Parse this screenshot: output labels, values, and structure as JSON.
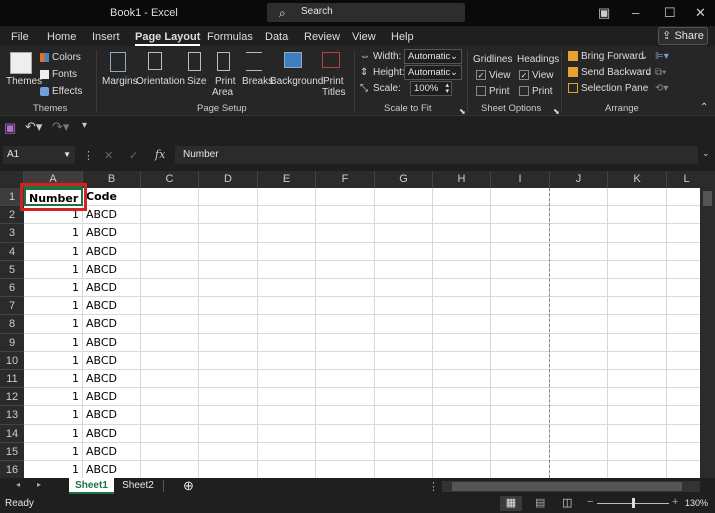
{
  "window": {
    "title": "Book1  -  Excel",
    "search_placeholder": "Search"
  },
  "tabs": [
    "File",
    "Home",
    "Insert",
    "Page Layout",
    "Formulas",
    "Data",
    "Review",
    "View",
    "Help"
  ],
  "active_tab": "Page Layout",
  "share_label": "Share",
  "ribbon": {
    "themes": {
      "themes": "Themes",
      "colors": "Colors",
      "fonts": "Fonts",
      "effects": "Effects",
      "group": "Themes"
    },
    "page_setup": {
      "margins": "Margins",
      "orientation": "Orientation",
      "size": "Size",
      "print_area_1": "Print",
      "print_area_2": "Area",
      "breaks": "Breaks",
      "background": "Background",
      "print_titles_1": "Print",
      "print_titles_2": "Titles",
      "group": "Page Setup"
    },
    "scale": {
      "width_label": "Width:",
      "width_value": "Automatic",
      "height_label": "Height:",
      "height_value": "Automatic",
      "scale_label": "Scale:",
      "scale_value": "100%",
      "group": "Scale to Fit"
    },
    "sheet_options": {
      "gridlines": "Gridlines",
      "headings": "Headings",
      "view": "View",
      "print": "Print",
      "gridlines_view": true,
      "gridlines_print": false,
      "headings_view": true,
      "headings_print": false,
      "group": "Sheet Options"
    },
    "arrange": {
      "bring_forward": "Bring Forward",
      "send_backward": "Send Backward",
      "selection_pane": "Selection Pane",
      "group": "Arrange"
    }
  },
  "formula_bar": {
    "name_box": "A1",
    "formula": "Number"
  },
  "columns": [
    "A",
    "B",
    "C",
    "D",
    "E",
    "F",
    "G",
    "H",
    "I",
    "J",
    "K",
    "L"
  ],
  "rows": [
    {
      "n": "1",
      "a": "Number",
      "b": "Code"
    },
    {
      "n": "2",
      "a": "1",
      "b": "ABCD"
    },
    {
      "n": "3",
      "a": "1",
      "b": "ABCD"
    },
    {
      "n": "4",
      "a": "1",
      "b": "ABCD"
    },
    {
      "n": "5",
      "a": "1",
      "b": "ABCD"
    },
    {
      "n": "6",
      "a": "1",
      "b": "ABCD"
    },
    {
      "n": "7",
      "a": "1",
      "b": "ABCD"
    },
    {
      "n": "8",
      "a": "1",
      "b": "ABCD"
    },
    {
      "n": "9",
      "a": "1",
      "b": "ABCD"
    },
    {
      "n": "10",
      "a": "1",
      "b": "ABCD"
    },
    {
      "n": "11",
      "a": "1",
      "b": "ABCD"
    },
    {
      "n": "12",
      "a": "1",
      "b": "ABCD"
    },
    {
      "n": "13",
      "a": "1",
      "b": "ABCD"
    },
    {
      "n": "14",
      "a": "1",
      "b": "ABCD"
    },
    {
      "n": "15",
      "a": "1",
      "b": "ABCD"
    },
    {
      "n": "16",
      "a": "1",
      "b": "ABCD"
    }
  ],
  "sheets": [
    "Sheet1",
    "Sheet2"
  ],
  "active_sheet": "Sheet1",
  "status": {
    "text": "Ready",
    "zoom": "130%"
  },
  "colors": {
    "highlight": "#d42020",
    "sheet_active": "#1e7145",
    "accent": "#1e7145"
  }
}
